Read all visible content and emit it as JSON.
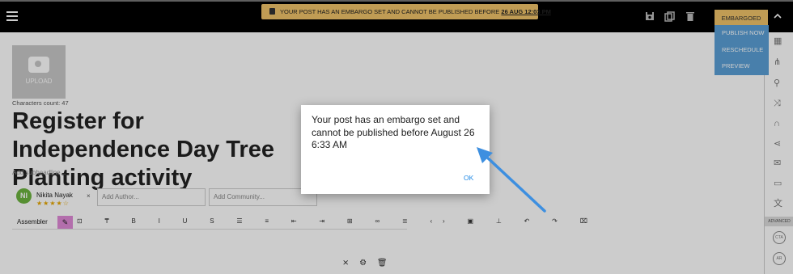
{
  "banner": {
    "text": "YOUR POST HAS AN EMBARGO SET AND CANNOT BE PUBLISHED BEFORE ",
    "date": "26 AUG 12:03 PM"
  },
  "topbar": {
    "status_label": "EMBARGOED",
    "icons": [
      "menu-icon",
      "save-icon",
      "copy-icon",
      "trash-icon",
      "chevron-up-icon"
    ]
  },
  "publish_menu": [
    "PUBLISH NOW",
    "RESCHEDULE",
    "PREVIEW"
  ],
  "upload": {
    "label": "UPLOAD"
  },
  "editor": {
    "char_count": "Characters count: 47",
    "headline": "Register for Independence Day Tree Planting activity",
    "subheadline_placeholder": "Add subheadline...",
    "author": {
      "initials": "NI",
      "name": "Nikita Nayak",
      "stars": "★★★★☆",
      "remove": "×"
    },
    "author_placeholder": "Add Author...",
    "community_placeholder": "Add Community...",
    "toolbar": {
      "label": "Assembler",
      "pen": "✎",
      "icons": "⊡ ₸ B I U S ☰ ≡ ⇤ ⇥ ⊞ ∞ ≣ ‹› ▣ ⊥ ↶ ↷ ⌧"
    }
  },
  "bottom_controls": {
    "collapse": "⨯",
    "settings": "⚙",
    "delete": "🗑"
  },
  "sidebar": {
    "advanced_label": "ADVANCED",
    "cta_label": "CTA",
    "ar_label": "AR"
  },
  "dialog": {
    "message": "Your post has an embargo set and cannot be published before August 26 6:33 AM",
    "ok": "OK"
  },
  "colors": {
    "banner": "#f0c46a",
    "menu": "#5a9fd6",
    "ok": "#1e88e5",
    "arrow": "#3d8fe0"
  }
}
